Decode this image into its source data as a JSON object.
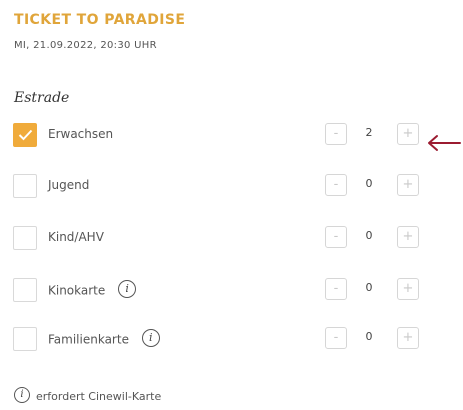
{
  "movie": {
    "title": "TICKET TO PARADISE",
    "showtime": "MI, 21.09.2022, 20:30 UHR"
  },
  "section_label": "Estrade",
  "tickets": [
    {
      "label": "Erwachsen",
      "checked": true,
      "quantity": "2",
      "info": false
    },
    {
      "label": "Jugend",
      "checked": false,
      "quantity": "0",
      "info": false
    },
    {
      "label": "Kind/AHV",
      "checked": false,
      "quantity": "0",
      "info": false
    },
    {
      "label": "Kinokarte",
      "checked": false,
      "quantity": "0",
      "info": true
    },
    {
      "label": "Familienkarte",
      "checked": false,
      "quantity": "0",
      "info": true
    }
  ],
  "stepper": {
    "minus": "-",
    "plus": "+"
  },
  "info_glyph": "i",
  "footnote": "erfordert Cinewil-Karte",
  "colors": {
    "accent": "#f0ab3b",
    "title": "#e0a53a",
    "arrow": "#9b1b30"
  }
}
